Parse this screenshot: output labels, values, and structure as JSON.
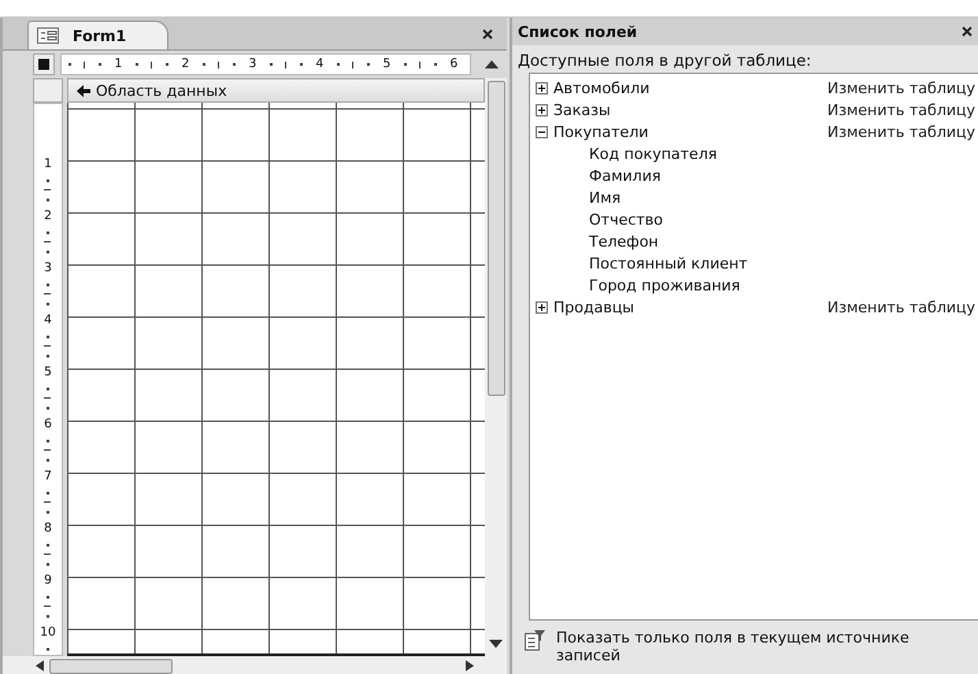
{
  "form_window": {
    "tab": {
      "title": "Form1",
      "selected": true
    },
    "ruler": {
      "horizontal": [
        "1",
        "2",
        "3",
        "4",
        "5",
        "6"
      ],
      "vertical": [
        "1",
        "2",
        "3",
        "4",
        "5",
        "6",
        "7",
        "8",
        "9",
        "10"
      ]
    },
    "section": {
      "title": "Область данных"
    }
  },
  "field_list": {
    "title": "Список полей",
    "caption": "Доступные поля в другой таблице:",
    "tables": [
      {
        "name": "Автомобили",
        "expanded": false,
        "action": "Изменить таблицу"
      },
      {
        "name": "Заказы",
        "expanded": false,
        "action": "Изменить таблицу"
      },
      {
        "name": "Покупатели",
        "expanded": true,
        "action": "Изменить таблицу",
        "children": [
          "Код покупателя",
          "Фамилия",
          "Имя",
          "Отчество",
          "Телефон",
          "Постоянный клиент",
          "Город проживания"
        ]
      },
      {
        "name": "Продавцы",
        "expanded": false,
        "action": "Изменить таблицу"
      }
    ],
    "footer": "Показать только поля в текущем источнике записей"
  }
}
